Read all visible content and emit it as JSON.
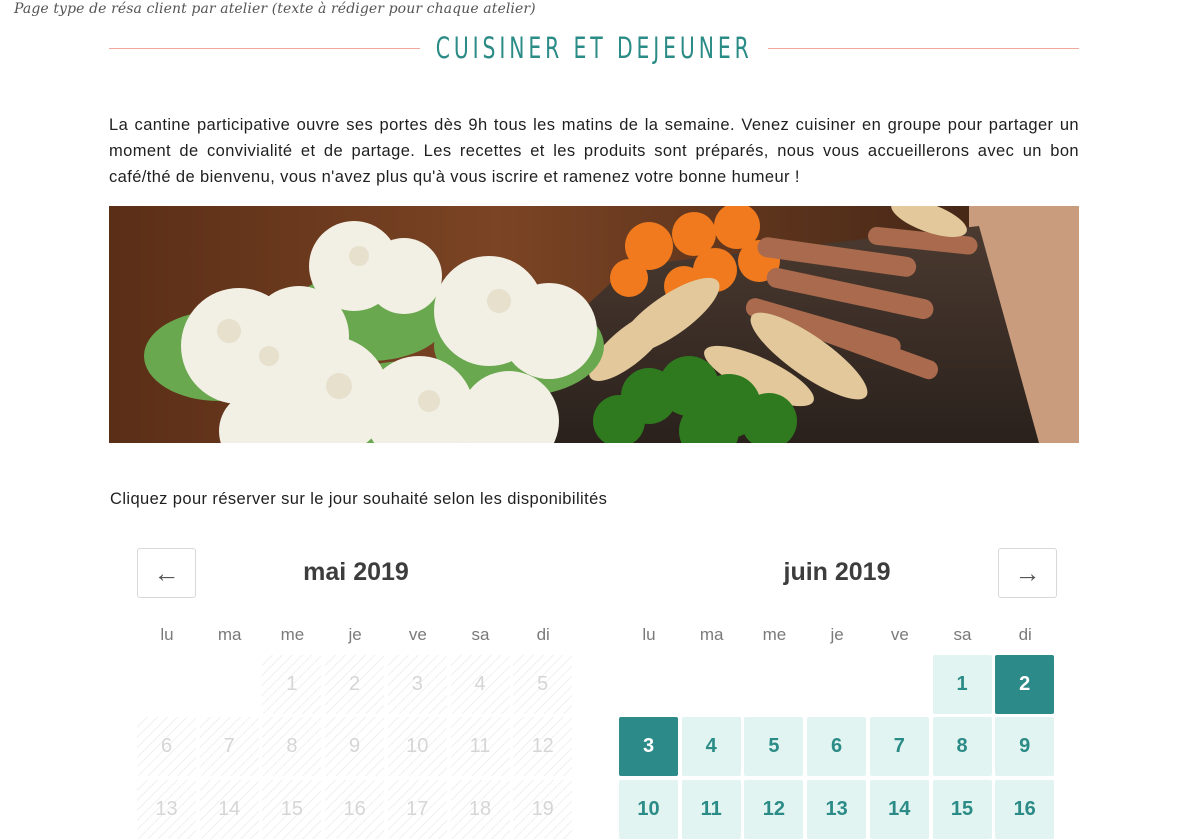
{
  "page_note": "Page type de résa client par atelier (texte à rédiger pour chaque atelier)",
  "title": "CUISINER ET DEJEUNER",
  "intro": "La cantine participative ouvre ses portes dès 9h tous les matins de la semaine. Venez cuisiner en groupe pour partager un moment de convivialité et de partage. Les recettes et les produits sont préparés, nous vous accueillerons avec un bon café/thé de bienvenu, vous n'avez plus qu'à vous iscrire et ramenez votre bonne humeur !",
  "hint": "Cliquez pour réserver sur le jour souhaité  selon les disponibilités",
  "calendar": {
    "prev_icon": "arrow-left-icon",
    "next_icon": "arrow-right-icon",
    "prev_glyph": "←",
    "next_glyph": "→",
    "weekdays": [
      "lu",
      "ma",
      "me",
      "je",
      "ve",
      "sa",
      "di"
    ],
    "months": [
      {
        "title": "mai 2019",
        "rows": [
          [
            "",
            "",
            "1",
            "2",
            "3",
            "4",
            "5"
          ],
          [
            "6",
            "7",
            "8",
            "9",
            "10",
            "11",
            "12"
          ],
          [
            "13",
            "14",
            "15",
            "16",
            "17",
            "18",
            "19"
          ]
        ],
        "state": "unavailable"
      },
      {
        "title": "juin 2019",
        "rows": [
          [
            "",
            "",
            "",
            "",
            "",
            "1",
            "2"
          ],
          [
            "3",
            "4",
            "5",
            "6",
            "7",
            "8",
            "9"
          ],
          [
            "10",
            "11",
            "12",
            "13",
            "14",
            "15",
            "16"
          ]
        ],
        "state": "available",
        "selected": [
          "2",
          "3"
        ]
      }
    ]
  },
  "colors": {
    "accent": "#2b8b86",
    "selected_bg": "#2c8a89",
    "available_bg": "#e2f4f1",
    "title_rule": "#f0a99c"
  }
}
